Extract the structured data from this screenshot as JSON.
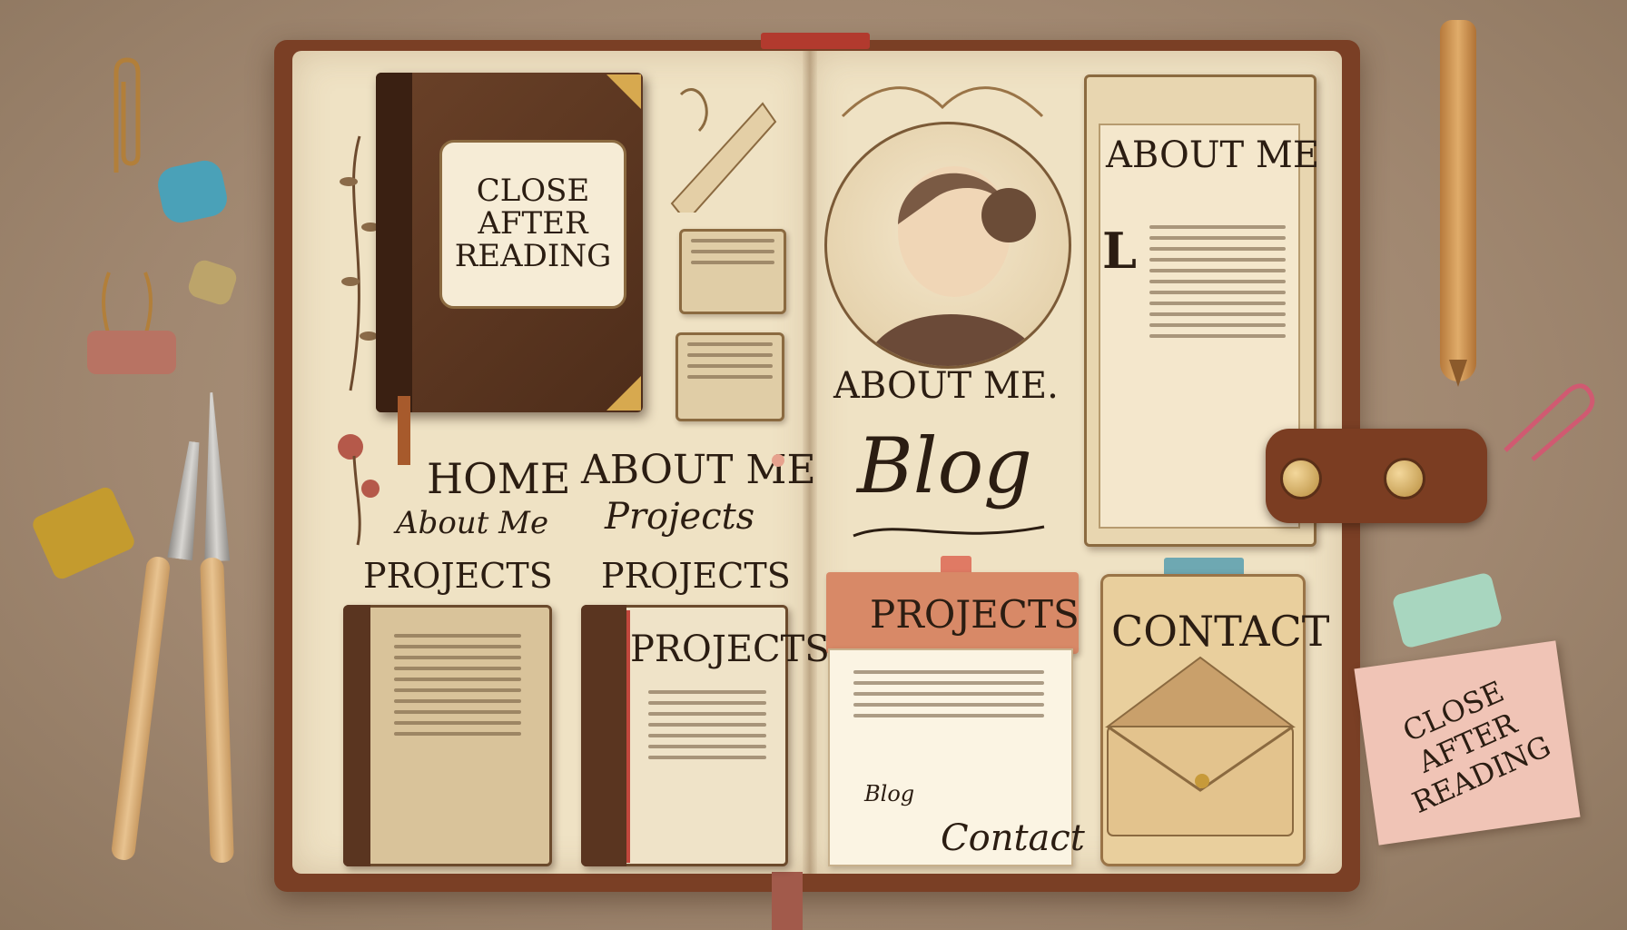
{
  "book_label": {
    "line1": "CLOSE",
    "line2": "AFTER",
    "line3": "READING"
  },
  "nav_left": {
    "col1": {
      "home": "HOME",
      "about": "About Me",
      "projects": "PROJECTS"
    },
    "col2": {
      "about": "ABOUT ME",
      "projects_script": "Projects",
      "projects": "PROJECTS"
    }
  },
  "proj_book_title": "PROJECTS",
  "right_page": {
    "about_me_caption": "ABOUT ME.",
    "blog_title": "Blog",
    "about_card_title": "ABOUT ME",
    "about_card_dropcap": "L"
  },
  "projects_card": {
    "header": "PROJECTS",
    "list_items": [
      "Blog"
    ],
    "footer": "Contact"
  },
  "contact_card": {
    "title": "CONTACT"
  },
  "sticky_note": {
    "line1": "CLOSE",
    "line2": "AFTER",
    "line3": "READING"
  },
  "colors": {
    "page": "#efe2c4",
    "leather": "#7a3f25",
    "ink": "#2b1d12",
    "projects_tab": "#d88967",
    "sticky": "#f0c4b6"
  },
  "icons": [
    "paperclip-icon",
    "envelope-icon",
    "portrait-illustration",
    "pen-icon",
    "brush-icon",
    "binder-clip-icon"
  ]
}
